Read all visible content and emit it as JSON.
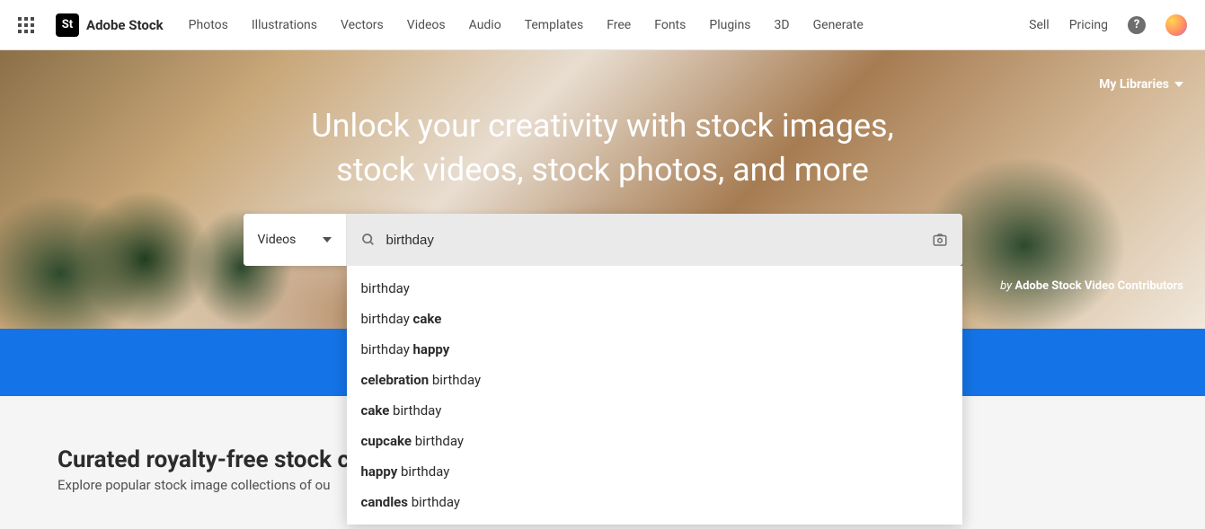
{
  "brand": "Adobe Stock",
  "logo_letters": "St",
  "nav": [
    "Photos",
    "Illustrations",
    "Vectors",
    "Videos",
    "Audio",
    "Templates",
    "Free",
    "Fonts",
    "Plugins",
    "3D",
    "Generate"
  ],
  "right_nav": [
    "Sell",
    "Pricing"
  ],
  "my_libraries": "My Libraries",
  "hero_title_line1": "Unlock your creativity with stock images,",
  "hero_title_line2": "stock videos, stock photos, and more",
  "credit_prefix": "by ",
  "credit_name": "Adobe Stock Video Contributors",
  "search_category": "Videos",
  "search_value": "birthday",
  "suggestions": [
    {
      "plain": "birthday",
      "bold": ""
    },
    {
      "plain": "birthday ",
      "bold": "cake"
    },
    {
      "plain": "birthday ",
      "bold": "happy"
    },
    {
      "bold": "celebration",
      "plain": " birthday",
      "bold_first": true
    },
    {
      "bold": "cake",
      "plain": " birthday",
      "bold_first": true
    },
    {
      "bold": "cupcake",
      "plain": " birthday",
      "bold_first": true
    },
    {
      "bold": "happy",
      "plain": " birthday",
      "bold_first": true
    },
    {
      "bold": "candles",
      "plain": " birthday",
      "bold_first": true
    }
  ],
  "curated_title": "Curated royalty-free stock c",
  "curated_desc": "Explore popular stock image collections of ou"
}
